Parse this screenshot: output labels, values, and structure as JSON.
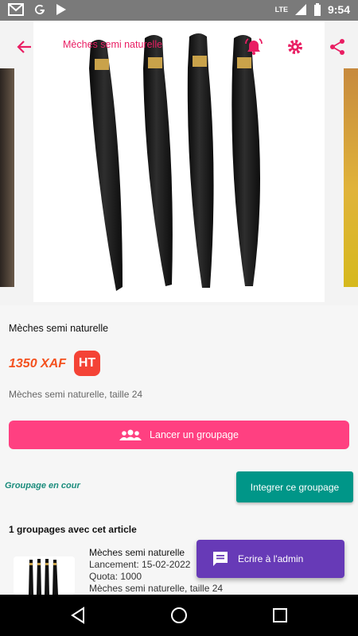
{
  "status_bar": {
    "time": "9:54",
    "network": "LTE",
    "icons": [
      "gmail-icon",
      "google-icon",
      "play-store-icon"
    ]
  },
  "header": {
    "title": "Mèches semi naturelle",
    "icons": [
      "back-arrow-icon",
      "bell-icon",
      "gear-icon",
      "share-icon"
    ]
  },
  "product": {
    "name": "Mèches semi naturelle",
    "price": "1350 XAF",
    "badge": "HT",
    "description": "Mèches semi naturelle, taille 24"
  },
  "actions": {
    "launch_label": "Lancer un groupage",
    "groupage_status": "Groupage en cour",
    "integrate_label": "Integrer ce groupage"
  },
  "groupages": {
    "count_label": "1 groupages avec cet article",
    "items": [
      {
        "title": "Mèches semi naturelle",
        "launch": "Lancement: 15-02-2022",
        "quota": "Quota: 1000",
        "description": "Mèches semi naturelle, taille 24"
      }
    ]
  },
  "fab": {
    "label": "Ecrire à l'admin",
    "icon": "message-icon"
  },
  "colors": {
    "accent": "#e91e63",
    "pink_button": "#ff4081",
    "teal": "#009688",
    "purple": "#673ab7",
    "price": "#f4511e",
    "badge": "#f44336"
  },
  "nav_bar": {
    "icons": [
      "back-triangle-icon",
      "home-circle-icon",
      "recents-square-icon"
    ]
  }
}
